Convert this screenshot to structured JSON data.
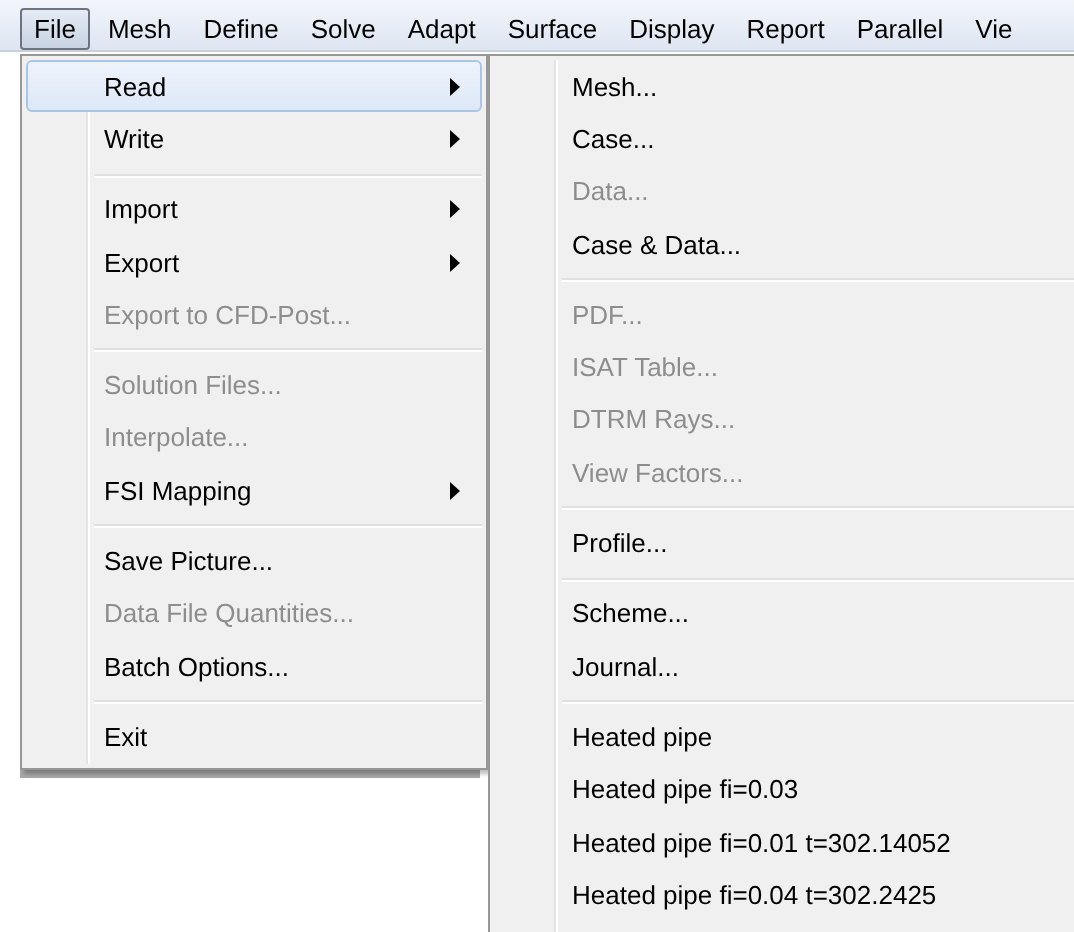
{
  "menubar": [
    {
      "label": "File",
      "selected": true
    },
    {
      "label": "Mesh",
      "selected": false
    },
    {
      "label": "Define",
      "selected": false
    },
    {
      "label": "Solve",
      "selected": false
    },
    {
      "label": "Adapt",
      "selected": false
    },
    {
      "label": "Surface",
      "selected": false
    },
    {
      "label": "Display",
      "selected": false
    },
    {
      "label": "Report",
      "selected": false
    },
    {
      "label": "Parallel",
      "selected": false
    },
    {
      "label": "Vie",
      "selected": false
    }
  ],
  "file_menu": [
    {
      "kind": "item",
      "label": "Read",
      "disabled": false,
      "submenu": true,
      "selected": true
    },
    {
      "kind": "item",
      "label": "Write",
      "disabled": false,
      "submenu": true,
      "selected": false
    },
    {
      "kind": "separator"
    },
    {
      "kind": "item",
      "label": "Import",
      "disabled": false,
      "submenu": true,
      "selected": false
    },
    {
      "kind": "item",
      "label": "Export",
      "disabled": false,
      "submenu": true,
      "selected": false
    },
    {
      "kind": "item",
      "label": "Export to CFD-Post...",
      "disabled": true,
      "submenu": false,
      "selected": false
    },
    {
      "kind": "separator"
    },
    {
      "kind": "item",
      "label": "Solution Files...",
      "disabled": true,
      "submenu": false,
      "selected": false
    },
    {
      "kind": "item",
      "label": "Interpolate...",
      "disabled": true,
      "submenu": false,
      "selected": false
    },
    {
      "kind": "item",
      "label": "FSI Mapping",
      "disabled": false,
      "submenu": true,
      "selected": false
    },
    {
      "kind": "separator"
    },
    {
      "kind": "item",
      "label": "Save Picture...",
      "disabled": false,
      "submenu": false,
      "selected": false
    },
    {
      "kind": "item",
      "label": "Data File Quantities...",
      "disabled": true,
      "submenu": false,
      "selected": false
    },
    {
      "kind": "item",
      "label": "Batch Options...",
      "disabled": false,
      "submenu": false,
      "selected": false
    },
    {
      "kind": "separator"
    },
    {
      "kind": "item",
      "label": "Exit",
      "disabled": false,
      "submenu": false,
      "selected": false
    }
  ],
  "read_submenu": [
    {
      "kind": "item",
      "label": "Mesh...",
      "disabled": false
    },
    {
      "kind": "item",
      "label": "Case...",
      "disabled": false
    },
    {
      "kind": "item",
      "label": "Data...",
      "disabled": true
    },
    {
      "kind": "item",
      "label": "Case & Data...",
      "disabled": false
    },
    {
      "kind": "separator"
    },
    {
      "kind": "item",
      "label": "PDF...",
      "disabled": true
    },
    {
      "kind": "item",
      "label": "ISAT Table...",
      "disabled": true
    },
    {
      "kind": "item",
      "label": "DTRM Rays...",
      "disabled": true
    },
    {
      "kind": "item",
      "label": "View Factors...",
      "disabled": true
    },
    {
      "kind": "separator"
    },
    {
      "kind": "item",
      "label": "Profile...",
      "disabled": false
    },
    {
      "kind": "separator"
    },
    {
      "kind": "item",
      "label": "Scheme...",
      "disabled": false
    },
    {
      "kind": "item",
      "label": "Journal...",
      "disabled": false
    },
    {
      "kind": "separator"
    },
    {
      "kind": "item",
      "label": "Heated pipe",
      "disabled": false
    },
    {
      "kind": "item",
      "label": "Heated pipe fi=0.03",
      "disabled": false
    },
    {
      "kind": "item",
      "label": "Heated pipe fi=0.01 t=302.14052",
      "disabled": false
    },
    {
      "kind": "item",
      "label": "Heated pipe fi=0.04 t=302.2425",
      "disabled": false
    }
  ]
}
